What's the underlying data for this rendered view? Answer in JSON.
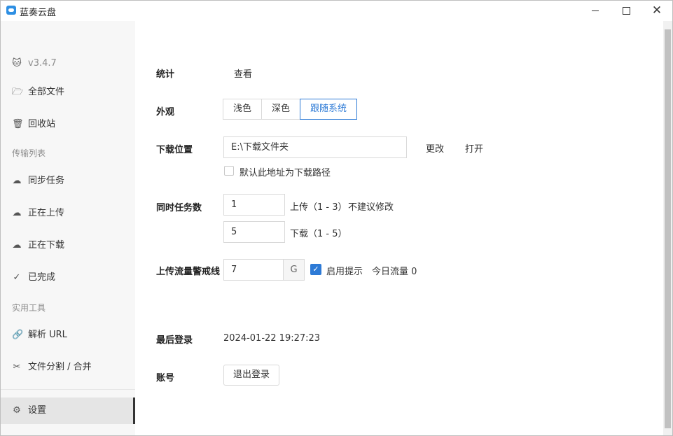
{
  "app": {
    "title": "蓝奏云盘"
  },
  "window_controls": {
    "minimize": "minimize",
    "maximize": "maximize",
    "close": "✕"
  },
  "sidebar": {
    "version": "v3.4.7",
    "items": [
      {
        "icon": "folder-icon",
        "label": "全部文件"
      },
      {
        "icon": "trash-icon",
        "label": "回收站"
      },
      {
        "icon": "sync-icon",
        "label": "同步任务"
      },
      {
        "icon": "upload-icon",
        "label": "正在上传"
      },
      {
        "icon": "download-icon",
        "label": "正在下载"
      },
      {
        "icon": "check-circle-icon",
        "label": "已完成"
      },
      {
        "icon": "link-icon",
        "label": "解析 URL"
      },
      {
        "icon": "scissors-icon",
        "label": "文件分割 / 合并"
      },
      {
        "icon": "gear-icon",
        "label": "设置"
      }
    ],
    "sections": {
      "transfer": "传输列表",
      "tools": "实用工具"
    }
  },
  "settings": {
    "stats": {
      "label": "统计",
      "action": "查看"
    },
    "appearance": {
      "label": "外观",
      "options": [
        "浅色",
        "深色",
        "跟随系统"
      ],
      "selected": "跟随系统"
    },
    "download_location": {
      "label": "下载位置",
      "value": "E:\\下载文件夹",
      "change": "更改",
      "open": "打开",
      "default_checkbox_label": "默认此地址为下载路径",
      "default_checked": false
    },
    "concurrent": {
      "label": "同时任务数",
      "upload_value": "1",
      "upload_text": "上传（1 - 3）",
      "upload_hint": "不建议修改",
      "download_value": "5",
      "download_text": "下载（1 - 5）"
    },
    "upload_limit": {
      "label": "上传流量警戒线",
      "value": "7",
      "unit": "G",
      "alert_label": "启用提示",
      "alert_checked": true,
      "today": "今日流量 0"
    },
    "last_login": {
      "label": "最后登录",
      "value": "2024-01-22 19:27:23"
    },
    "account": {
      "label": "账号",
      "logout": "退出登录"
    }
  },
  "colors": {
    "accent": "#2d7ad6",
    "sidebar_bg": "#f7f7f7",
    "active_bg": "#e5e5e5"
  }
}
